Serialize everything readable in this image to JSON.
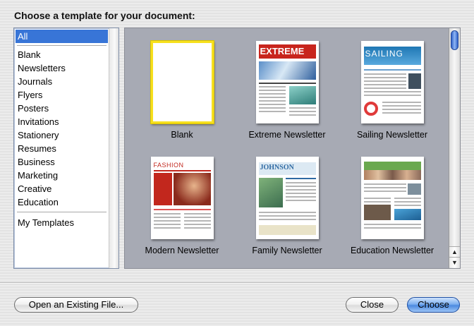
{
  "dialog": {
    "title": "Choose a template for your document:"
  },
  "categories": {
    "all": "All",
    "items": [
      "Blank",
      "Newsletters",
      "Journals",
      "Flyers",
      "Posters",
      "Invitations",
      "Stationery",
      "Resumes",
      "Business",
      "Marketing",
      "Creative",
      "Education"
    ],
    "my_templates": "My Templates"
  },
  "templates": [
    {
      "label": "Blank"
    },
    {
      "label": "Extreme Newsletter",
      "masthead": "EXTREME"
    },
    {
      "label": "Sailing Newsletter",
      "masthead": "SAILING"
    },
    {
      "label": "Modern Newsletter",
      "masthead": "FASHION"
    },
    {
      "label": "Family Newsletter",
      "masthead": "JOHNSON"
    },
    {
      "label": "Education Newsletter"
    }
  ],
  "buttons": {
    "open_existing": "Open an Existing File...",
    "close": "Close",
    "choose": "Choose"
  },
  "colors": {
    "selection": "#3875d7",
    "template_bg": "#a7aab4",
    "selected_border": "#f7e01e"
  }
}
